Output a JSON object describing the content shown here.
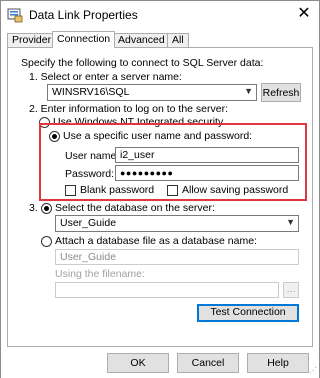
{
  "window": {
    "title": "Data Link Properties",
    "close_symbol": "✕"
  },
  "tabs": [
    {
      "label": "Provider"
    },
    {
      "label": "Connection",
      "active": true
    },
    {
      "label": "Advanced"
    },
    {
      "label": "All"
    }
  ],
  "intro": "Specify the following to connect to SQL Server data:",
  "step1": {
    "label": "1. Select or enter a server name:",
    "server_value": "WINSRV16\\SQL",
    "refresh_label": "Refresh"
  },
  "step2": {
    "label": "2. Enter information to log on to the server:",
    "option_nt": "Use Windows NT Integrated security",
    "option_specific": "Use a specific user name and password:",
    "username_label": "User name:",
    "username_value": "i2_user",
    "password_label": "Password:",
    "password_value": "●●●●●●●●●",
    "blank_password": "Blank password",
    "allow_saving": "Allow saving password"
  },
  "step3": {
    "label_prefix": "3.",
    "option_select": "Select the database on the server:",
    "database_value": "User_Guide",
    "option_attach": "Attach a database file as a database name:",
    "attach_value": "User_Guide",
    "using_filename": "Using the filename:",
    "browse_label": "...",
    "test_label": "Test Connection"
  },
  "footer": {
    "ok": "OK",
    "cancel": "Cancel",
    "help": "Help"
  },
  "colors": {
    "highlight_border": "#e0383e",
    "focus_blue": "#0078d7"
  }
}
